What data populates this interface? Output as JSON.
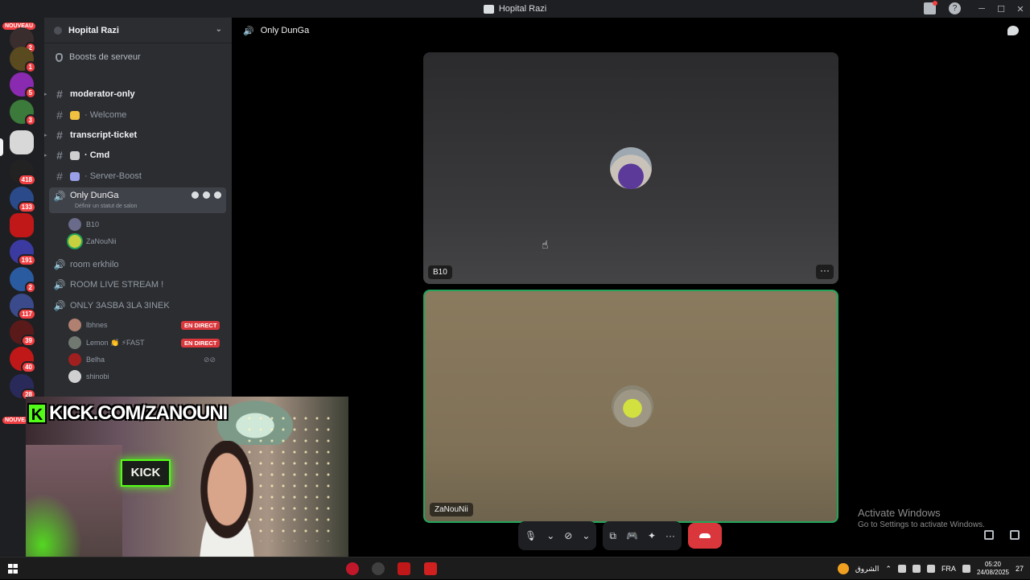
{
  "window": {
    "title": "Hopital Razi"
  },
  "guilds": {
    "new_label_top": "NOUVEAU",
    "new_label_bottom": "NOUVEAU",
    "badges": [
      "2",
      "1",
      "5",
      "3",
      "418",
      "133",
      "191",
      "2",
      "117",
      "39",
      "40",
      "28"
    ]
  },
  "server": {
    "name": "Hopital Razi",
    "boost_label": "Boosts de serveur"
  },
  "channels": {
    "text": [
      {
        "name": "moderator-only",
        "bold": true
      },
      {
        "name": "· Welcome",
        "bold": false
      },
      {
        "name": "transcript-ticket",
        "bold": true
      },
      {
        "name": "· Cmd",
        "bold": true
      },
      {
        "name": "· Server-Boost",
        "bold": false
      }
    ],
    "voice_active": {
      "name": "Only DunGa",
      "status_hint": "Définir un statut de salon",
      "members": [
        "B10",
        "ZaNouNii"
      ]
    },
    "voice_other": [
      {
        "name": "room erkhilo"
      },
      {
        "name": "ROOM LIVE STREAM !"
      },
      {
        "name": "ONLY 3ASBA 3LA 3INEK"
      }
    ],
    "voice_other_members": [
      {
        "name": "lbhnes",
        "live": "EN DIRECT"
      },
      {
        "name": "Lemon 👏 ⚡FAST",
        "live": "EN DIRECT"
      },
      {
        "name": "Belha",
        "live": ""
      },
      {
        "name": "shinobi",
        "live": ""
      }
    ]
  },
  "call": {
    "channel_title": "Only DunGa",
    "participants": [
      {
        "name": "B10"
      },
      {
        "name": "ZaNouNii",
        "speaking": true
      }
    ]
  },
  "stream_overlay": {
    "banner": "KICK.COM/ZANOUNI",
    "banner_logo": "K",
    "sign": "KICK"
  },
  "activation": {
    "title": "Activate Windows",
    "subtitle": "Go to Settings to activate Windows."
  },
  "taskbar": {
    "weather": "الشروق",
    "lang": "FRA",
    "time": "05:20",
    "date": "24/08/2025",
    "notif": "27"
  },
  "colors": {
    "speaking_border": "#23a55a",
    "live_badge": "#da373c",
    "kick_green": "#53fc18"
  }
}
